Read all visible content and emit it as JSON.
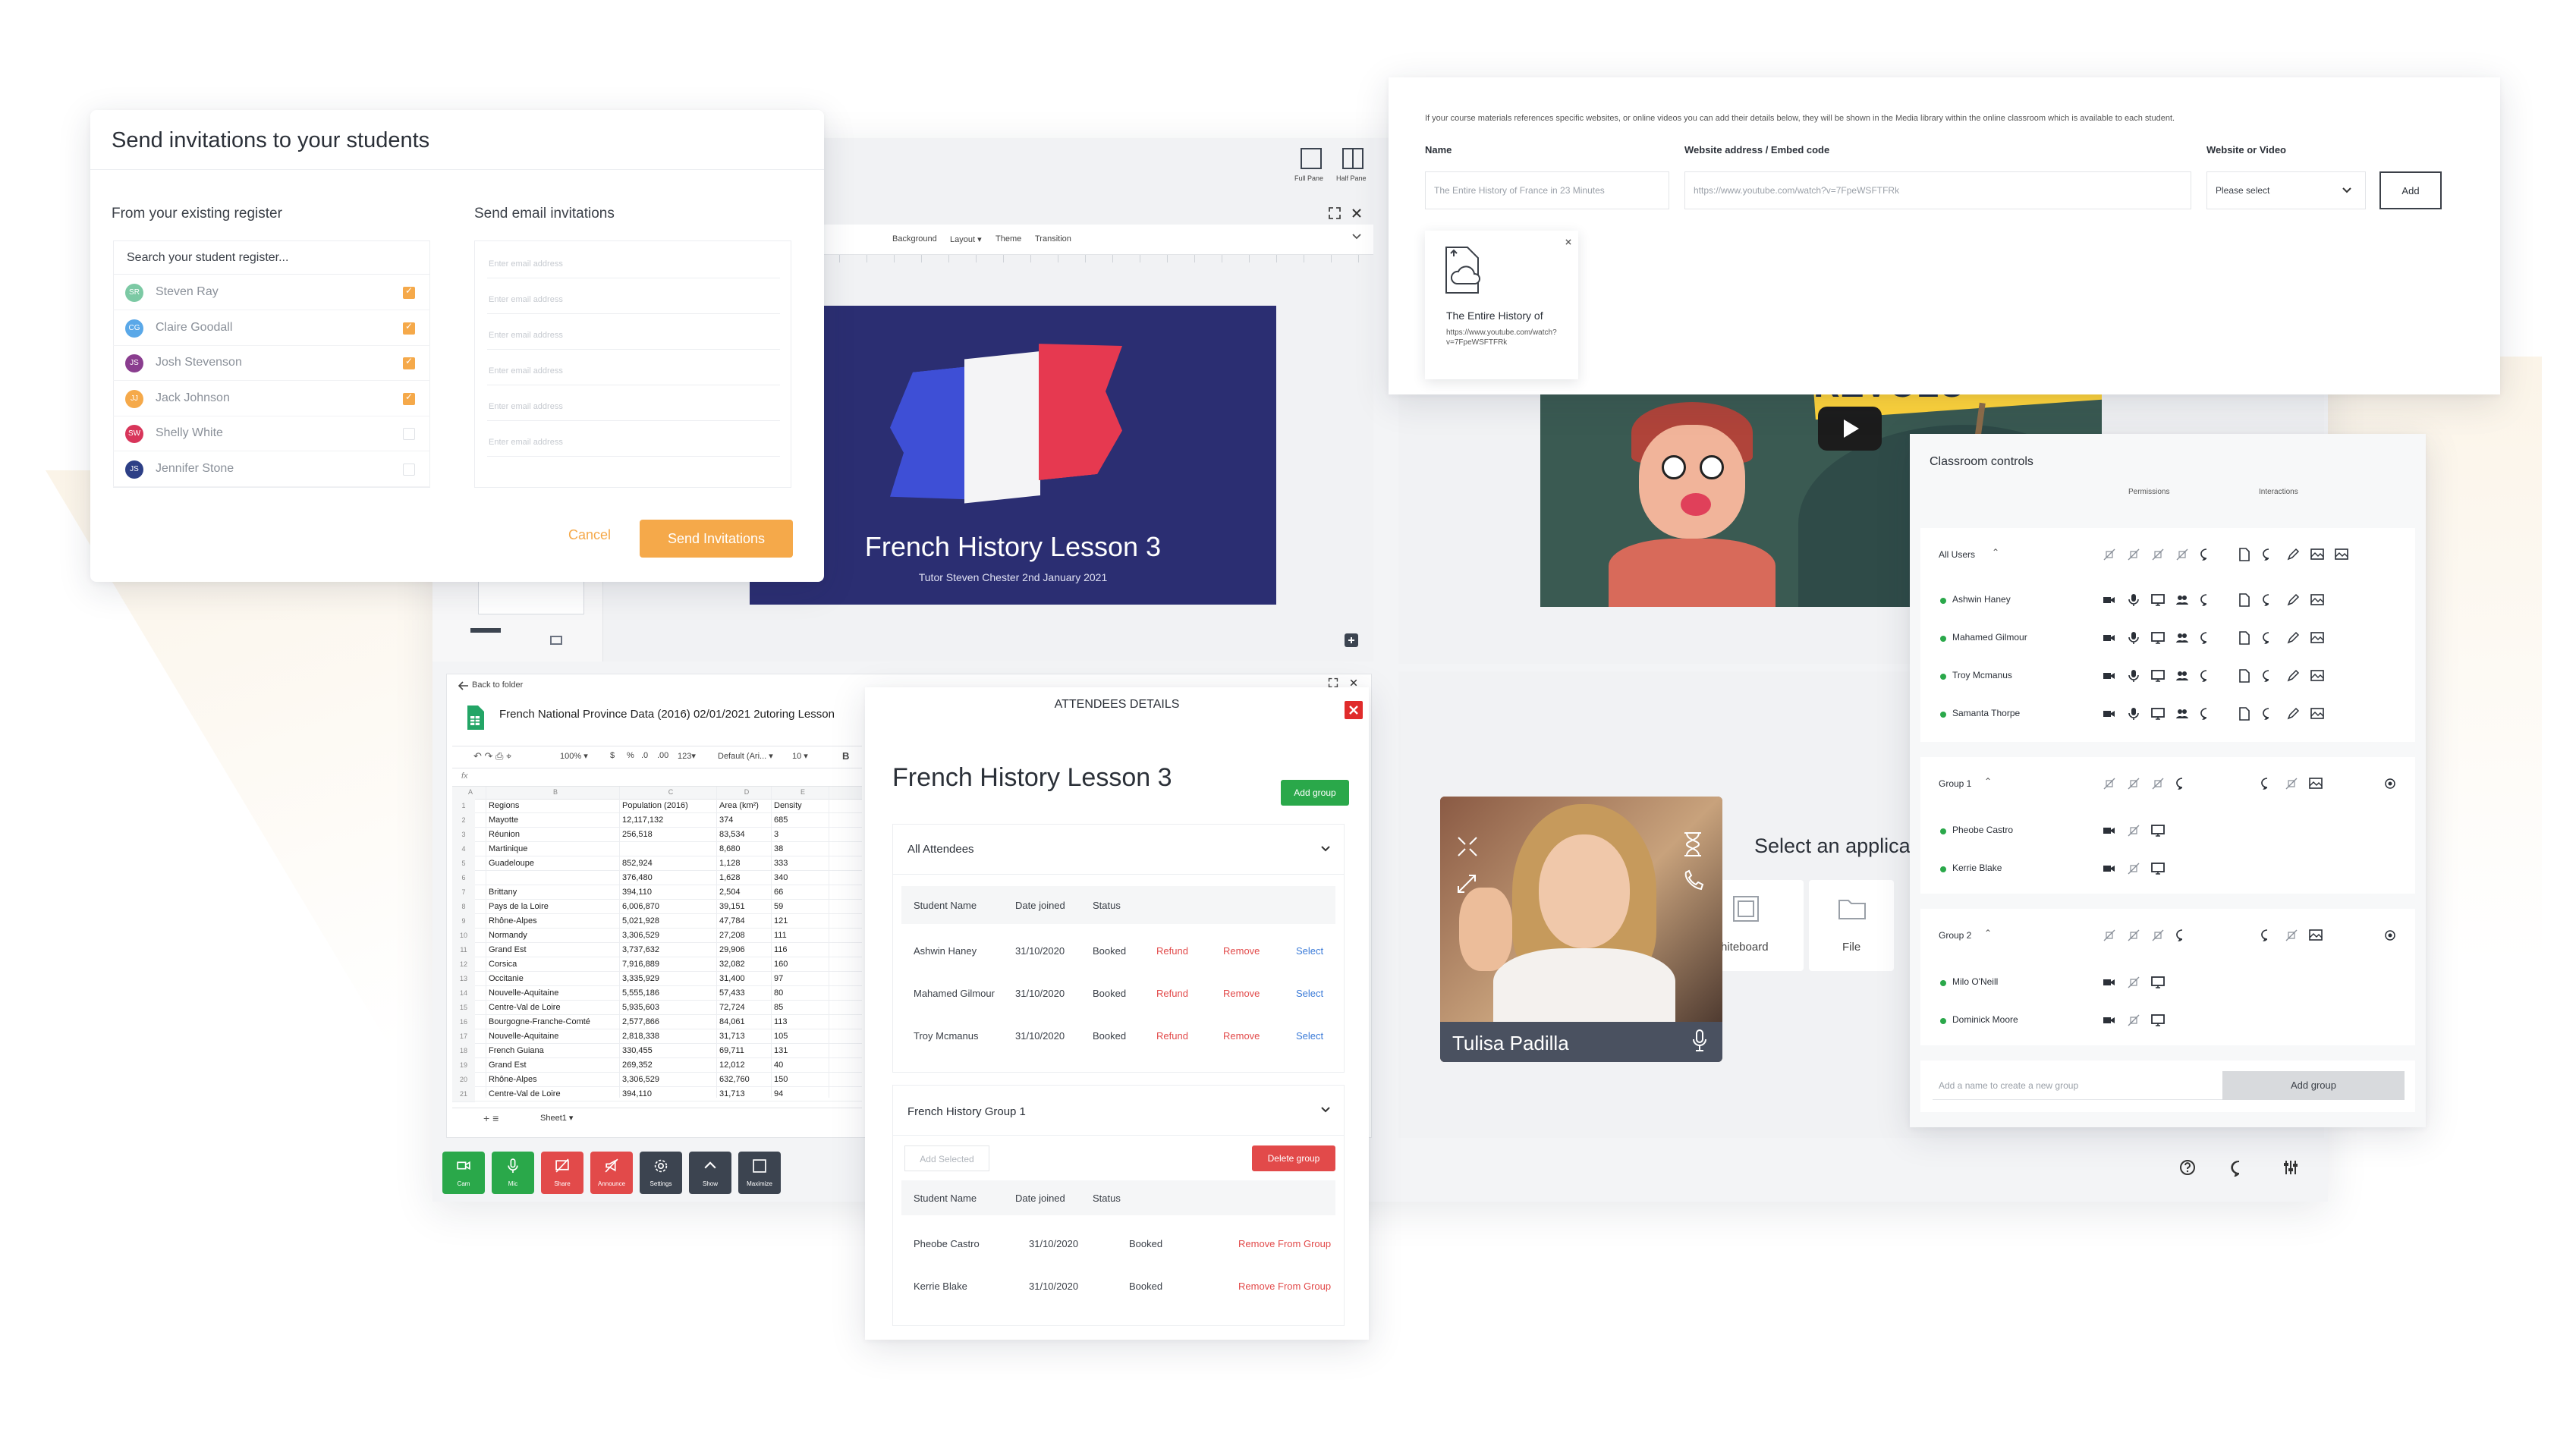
{
  "invite": {
    "title": "Send invitations to your students",
    "existing_label": "From your existing register",
    "email_label": "Send email invitations",
    "search_placeholder": "Search your student register...",
    "students": [
      {
        "initials": "SR",
        "name": "Steven Ray",
        "color": "#7cc9a4",
        "checked": true
      },
      {
        "initials": "CG",
        "name": "Claire Goodall",
        "color": "#5aa8e8",
        "checked": true
      },
      {
        "initials": "JS",
        "name": "Josh Stevenson",
        "color": "#8a3d8f",
        "checked": true
      },
      {
        "initials": "JJ",
        "name": "Jack Johnson",
        "color": "#f5a94a",
        "checked": true
      },
      {
        "initials": "SW",
        "name": "Shelly White",
        "color": "#d8355a",
        "checked": false
      },
      {
        "initials": "JS",
        "name": "Jennifer Stone",
        "color": "#2d3f86",
        "checked": false
      }
    ],
    "email_placeholder": "Enter email address",
    "cancel": "Cancel",
    "send": "Send Invitations"
  },
  "slides": {
    "toolbar": {
      "background": "Background",
      "layout": "Layout ▾",
      "theme": "Theme",
      "transition": "Transition"
    },
    "title": "French History Lesson 3",
    "subtitle": "Tutor Steven Chester 2nd January 2021",
    "pane_full": "Full Pane",
    "pane_half": "Half Pane"
  },
  "sheet": {
    "back": "Back to folder",
    "filename": "French National Province Data (2016) 02/01/2021 2utoring Lesson",
    "toolbar": {
      "zoom": "100% ▾",
      "currency": "$",
      "percent": "%",
      "dec": ".0",
      "dec2": ".00",
      "fmt": "123▾",
      "font": "Default (Ari... ▾",
      "size": "10 ▾",
      "bold": "B"
    },
    "col_letters": [
      "A",
      "B",
      "C",
      "D",
      "E"
    ],
    "headers": [
      "Regions",
      "Population (2016)",
      "Area (km²)",
      "Density"
    ],
    "rows": [
      [
        "Mayotte",
        "12,117,132",
        "374",
        "685"
      ],
      [
        "Réunion",
        "256,518",
        "83,534",
        "3"
      ],
      [
        "Martinique",
        "",
        "8,680",
        "38"
      ],
      [
        "Guadeloupe",
        "852,924",
        "1,128",
        "333"
      ],
      [
        "",
        "376,480",
        "1,628",
        "340"
      ],
      [
        "Brittany",
        "394,110",
        "2,504",
        "66"
      ],
      [
        "Pays de la Loire",
        "6,006,870",
        "39,151",
        "59"
      ],
      [
        "Rhône-Alpes",
        "5,021,928",
        "47,784",
        "121"
      ],
      [
        "Normandy",
        "3,306,529",
        "27,208",
        "111"
      ],
      [
        "Grand Est",
        "3,737,632",
        "29,906",
        "116"
      ],
      [
        "Corsica",
        "7,916,889",
        "32,082",
        "160"
      ],
      [
        "Occitanie",
        "3,335,929",
        "31,400",
        "97"
      ],
      [
        "Nouvelle-Aquitaine",
        "5,555,186",
        "57,433",
        "80"
      ],
      [
        "Centre-Val de Loire",
        "5,935,603",
        "72,724",
        "85"
      ],
      [
        "Bourgogne-Franche-Comté",
        "2,577,866",
        "84,061",
        "113"
      ],
      [
        "Nouvelle-Aquitaine",
        "2,818,338",
        "31,713",
        "105"
      ],
      [
        "French Guiana",
        "330,455",
        "69,711",
        "131"
      ],
      [
        "Grand Est",
        "269,352",
        "12,012",
        "40"
      ],
      [
        "Rhône-Alpes",
        "3,306,529",
        "632,760",
        "150"
      ],
      [
        "Centre-Val de Loire",
        "394,110",
        "31,713",
        "94"
      ]
    ],
    "sheet_tab": "Sheet1 ▾"
  },
  "dock": {
    "buttons": [
      {
        "label": "Cam",
        "icon": "camera-icon",
        "color": "#2aa84a"
      },
      {
        "label": "Mic",
        "icon": "mic-icon",
        "color": "#2aa84a"
      },
      {
        "label": "Share",
        "icon": "share-off-icon",
        "color": "#e24a4a"
      },
      {
        "label": "Announce",
        "icon": "announce-off-icon",
        "color": "#e24a4a"
      },
      {
        "label": "Settings",
        "icon": "gear-icon",
        "color": "#3c4450"
      },
      {
        "label": "Show",
        "icon": "chevron-up-icon",
        "color": "#3c4450"
      },
      {
        "label": "Maximize",
        "icon": "maximize-icon",
        "color": "#3c4450"
      }
    ]
  },
  "attendees": {
    "header": "ATTENDEES DETAILS",
    "lesson_title": "French History Lesson 3",
    "add_group": "Add group",
    "all_section": "All Attendees",
    "col_headers": [
      "Student Name",
      "Date joined",
      "Status"
    ],
    "all_rows": [
      {
        "name": "Ashwin Haney",
        "date": "31/10/2020",
        "status": "Booked",
        "refund": "Refund",
        "remove": "Remove",
        "select": "Select"
      },
      {
        "name": "Mahamed Gilmour",
        "date": "31/10/2020",
        "status": "Booked",
        "refund": "Refund",
        "remove": "Remove",
        "select": "Select"
      },
      {
        "name": "Troy Mcmanus",
        "date": "31/10/2020",
        "status": "Booked",
        "refund": "Refund",
        "remove": "Remove",
        "select": "Select"
      }
    ],
    "group_section": "French History Group 1",
    "add_selected": "Add Selected",
    "delete_group": "Delete group",
    "group_rows": [
      {
        "name": "Pheobe Castro",
        "date": "31/10/2020",
        "status": "Booked",
        "action": "Remove From Group"
      },
      {
        "name": "Kerrie Blake",
        "date": "31/10/2020",
        "status": "Booked",
        "action": "Remove From Group"
      }
    ]
  },
  "media": {
    "intro": "If your course materials references specific websites, or online videos you can add their details below, they will be shown in the Media library within the online classroom which is available to each student.",
    "name_label": "Name",
    "name_value": "The Entire History of France in 23 Minutes",
    "url_label": "Website address / Embed code",
    "url_value": "https://www.youtube.com/watch?v=7FpeWSFTFRk",
    "type_label": "Website or Video",
    "type_value": "Please select",
    "add": "Add",
    "item_title": "The Entire History of",
    "item_url": "https://www.youtube.com/watch?v=7FpeWSFTFRk"
  },
  "video": {
    "banner_text": "REVOLU"
  },
  "webcam": {
    "name": "Tulisa Padilla"
  },
  "apps": {
    "title": "Select an applica",
    "whiteboard": "hiteboard",
    "file": "File"
  },
  "controls": {
    "title": "Classroom controls",
    "permissions": "Permissions",
    "interactions": "Interactions",
    "all_users": "All Users",
    "users": [
      "Ashwin Haney",
      "Mahamed Gilmour",
      "Troy Mcmanus",
      "Samanta Thorpe"
    ],
    "group1": "Group 1",
    "group1_users": [
      "Pheobe Castro",
      "Kerrie Blake"
    ],
    "group2": "Group 2",
    "group2_users": [
      "Milo O'Neill",
      "Dominick Moore"
    ],
    "new_group_placeholder": "Add a name to create a new group",
    "add_group": "Add group"
  },
  "colors": {
    "accent_orange": "#f5a94a",
    "green": "#2aa84a",
    "red": "#e24a4a",
    "navy": "#2b2e72"
  }
}
